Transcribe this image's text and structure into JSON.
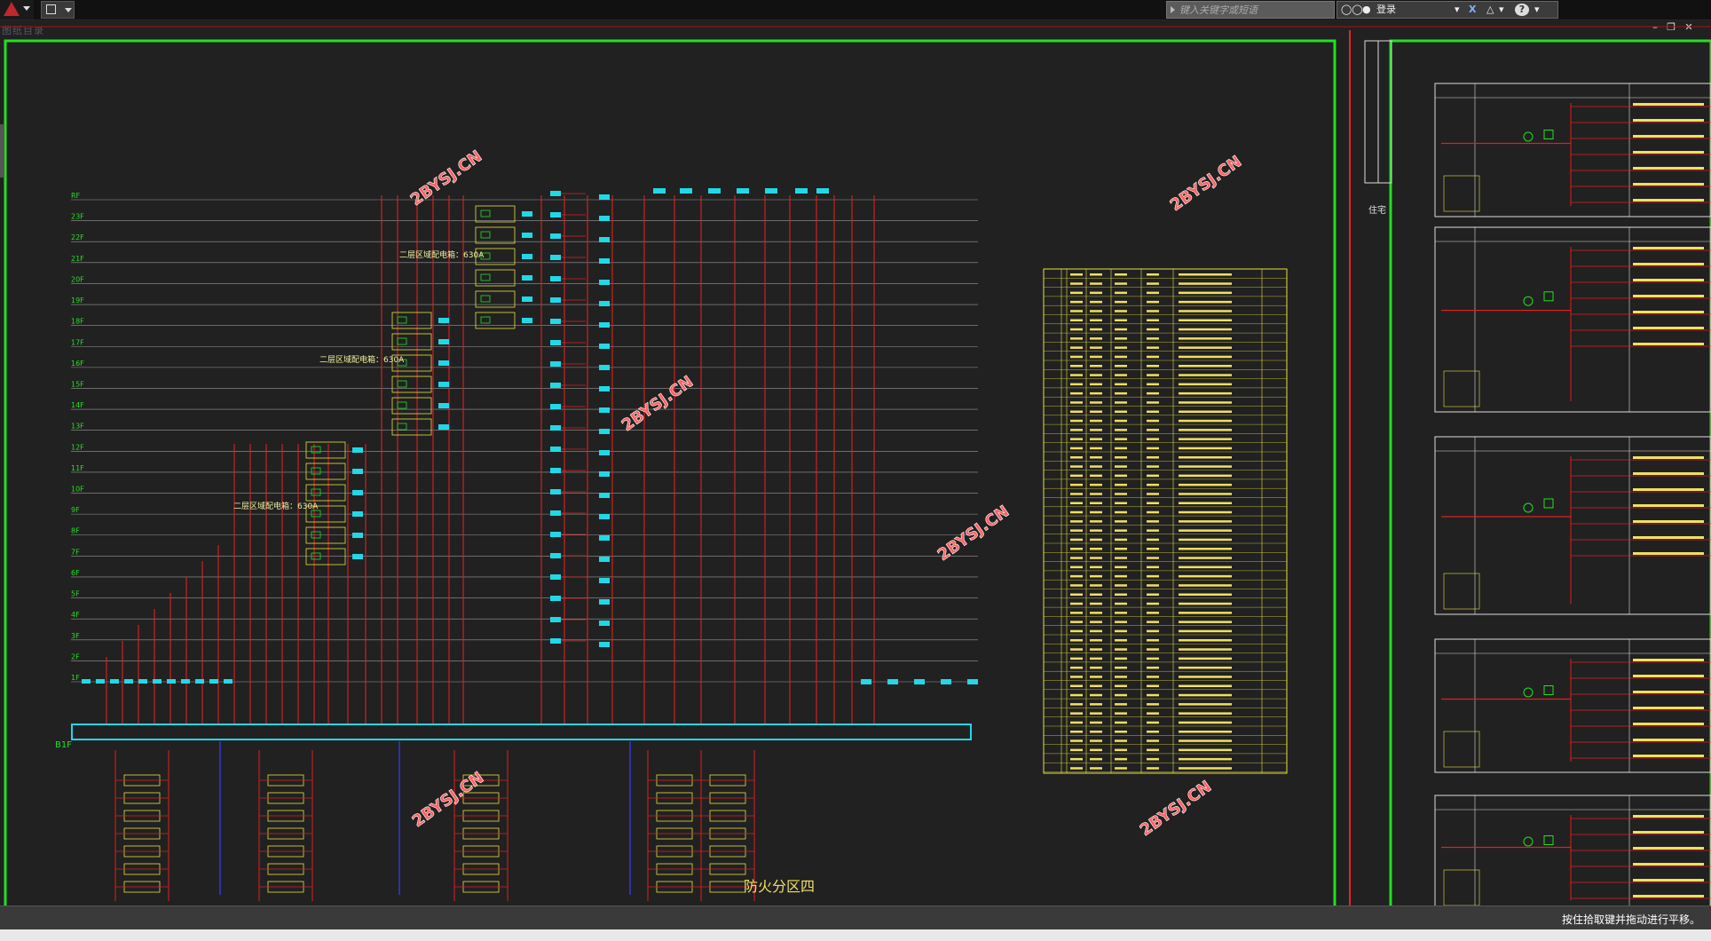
{
  "titlebar": {
    "search_placeholder": "键入关键字或短语",
    "login_label": "登录"
  },
  "drawing_tab": {
    "label": "图纸目录"
  },
  "canvas": {
    "watermarks": [
      "2BYSJ.CN",
      "2BYSJ.CN",
      "2BYSJ.CN",
      "2BYSJ.CN",
      "2BYSJ.CN",
      "2BYSJ.CN"
    ],
    "floor_labels": [
      "RF",
      "23F",
      "22F",
      "21F",
      "20F",
      "19F",
      "18F",
      "17F",
      "16F",
      "15F",
      "14F",
      "13F",
      "12F",
      "11F",
      "10F",
      "9F",
      "8F",
      "7F",
      "6F",
      "5F",
      "4F",
      "3F",
      "2F",
      "1F"
    ],
    "basement_label": "B1F",
    "box_notes": [
      "二层区域配电箱：630A",
      "二层区域配电箱：630A",
      "二层区域配电箱：630A"
    ],
    "zone_title": "防火分区四",
    "side_header": "住宅"
  },
  "status": {
    "message": "按住拾取键并拖动进行平移。"
  }
}
